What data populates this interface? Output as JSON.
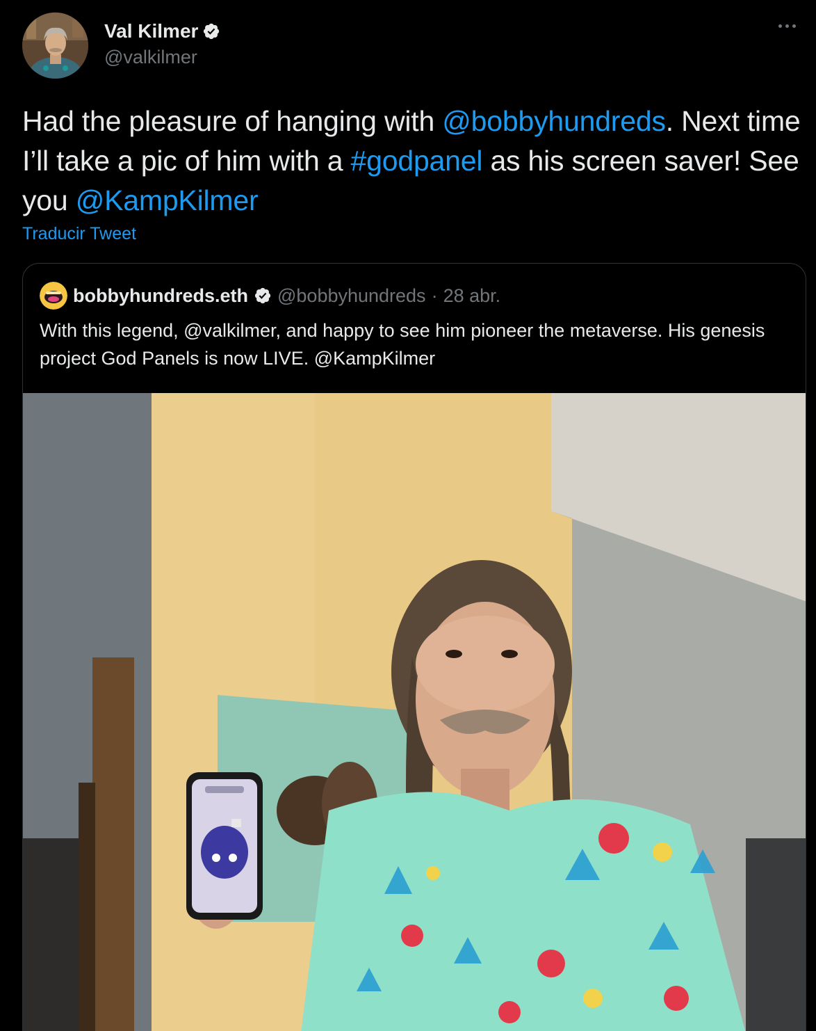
{
  "tweet": {
    "author": {
      "display_name": "Val Kilmer",
      "handle": "@valkilmer",
      "verified": true
    },
    "text_parts": [
      {
        "text": "Had the pleasure of hanging with ",
        "type": "plain"
      },
      {
        "text": "@bobbyhundreds",
        "type": "mention"
      },
      {
        "text": ". Next time I’ll take a pic of him with a ",
        "type": "plain"
      },
      {
        "text": "#godpanel",
        "type": "hashtag"
      },
      {
        "text": " as his screen saver! See you ",
        "type": "plain"
      },
      {
        "text": "@KampKilmer",
        "type": "mention"
      }
    ],
    "translate_label": "Traducir Tweet",
    "more_icon": "more-options-icon"
  },
  "quoted_tweet": {
    "display_name": "bobbyhundreds.eth",
    "handle": "@bobbyhundreds",
    "separator": "·",
    "date": "28 abr.",
    "verified": true,
    "text": "With this legend, @valkilmer, and happy to see him pioneer the metaverse. His genesis project God Panels is now LIVE. @KampKilmer"
  },
  "colors": {
    "background": "#000000",
    "text_primary": "#e7e9ea",
    "text_secondary": "#71767b",
    "link": "#1d9bf0",
    "border": "#2f3336",
    "verified": "#e7e9ea"
  }
}
